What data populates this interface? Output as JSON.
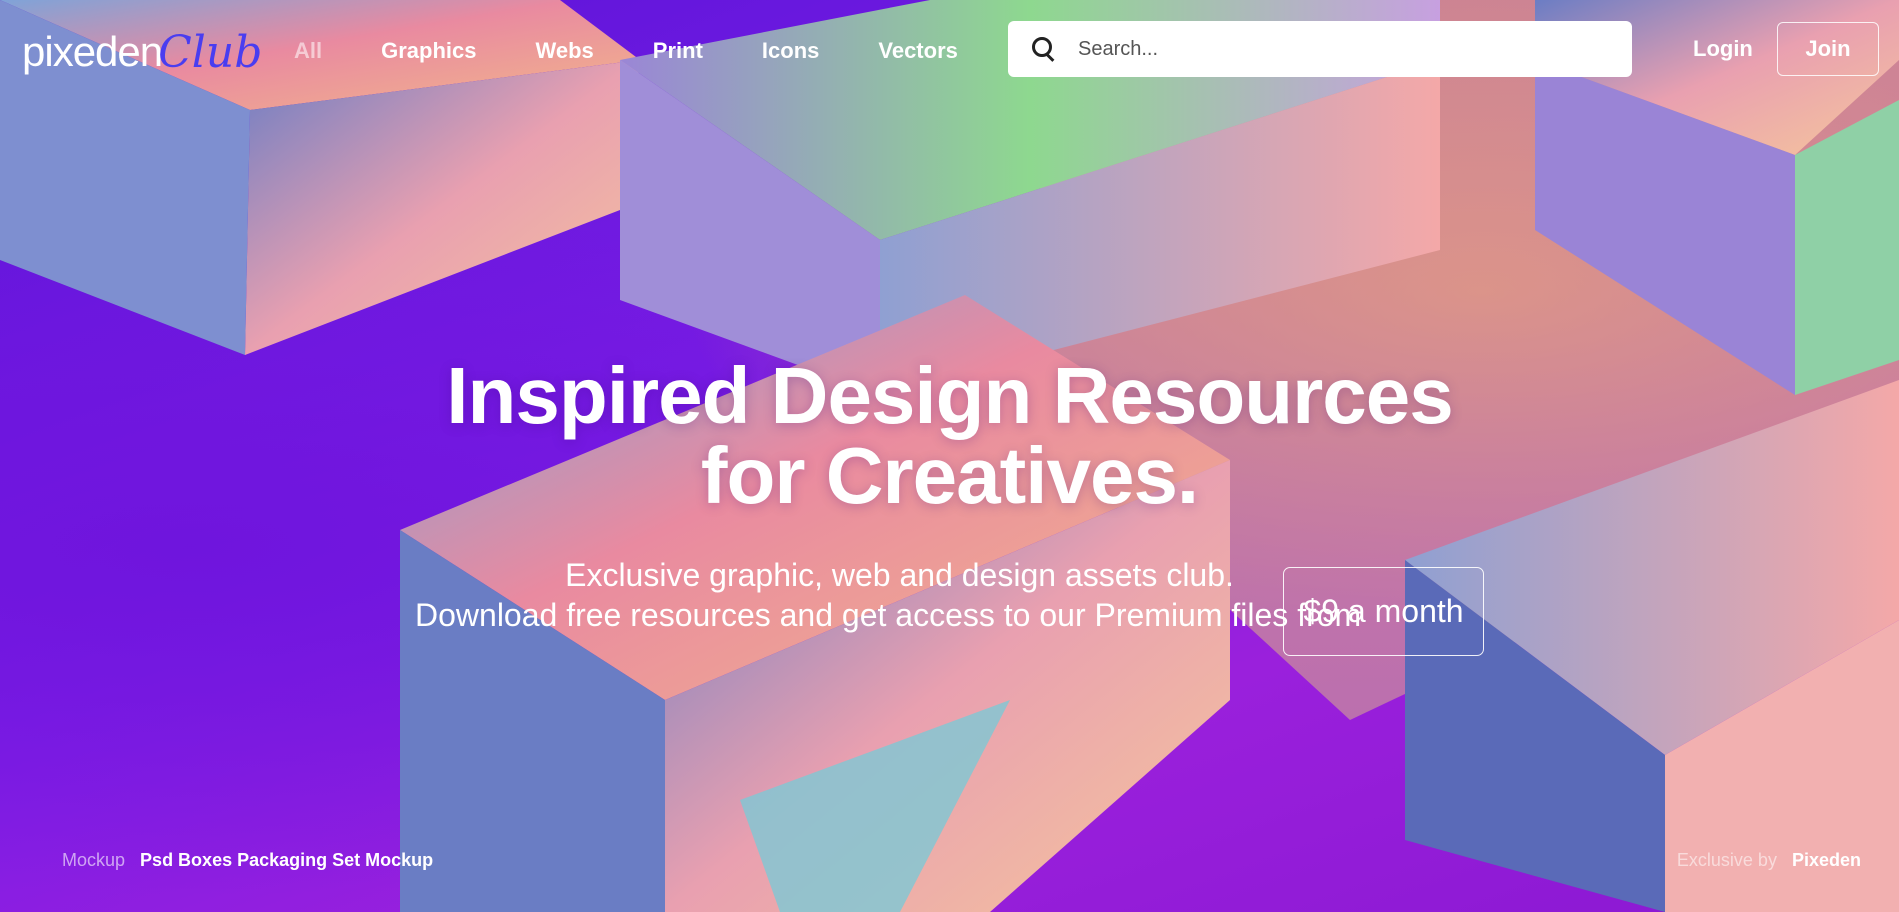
{
  "brand": {
    "name_main": "pixeden",
    "name_script": "Club"
  },
  "nav": {
    "items": [
      "All",
      "Graphics",
      "Webs",
      "Print",
      "Icons",
      "Vectors"
    ]
  },
  "search": {
    "placeholder": "Search...",
    "value": ""
  },
  "auth": {
    "login": "Login",
    "join": "Join"
  },
  "hero": {
    "headline_line1": "Inspired Design Resources",
    "headline_line2": "for Creatives.",
    "sub_line1": "Exclusive graphic, web and design assets club.",
    "sub_line2": "Download free resources and get access to our Premium files from",
    "price_cta": "$9 a month"
  },
  "credit": {
    "left_label": "Mockup",
    "left_value": "Psd Boxes Packaging Set Mockup",
    "right_label": "Exclusive by",
    "right_value": "Pixeden"
  },
  "colors": {
    "background_purple": "#7a1fe0",
    "logo_script": "#4a3df0"
  }
}
